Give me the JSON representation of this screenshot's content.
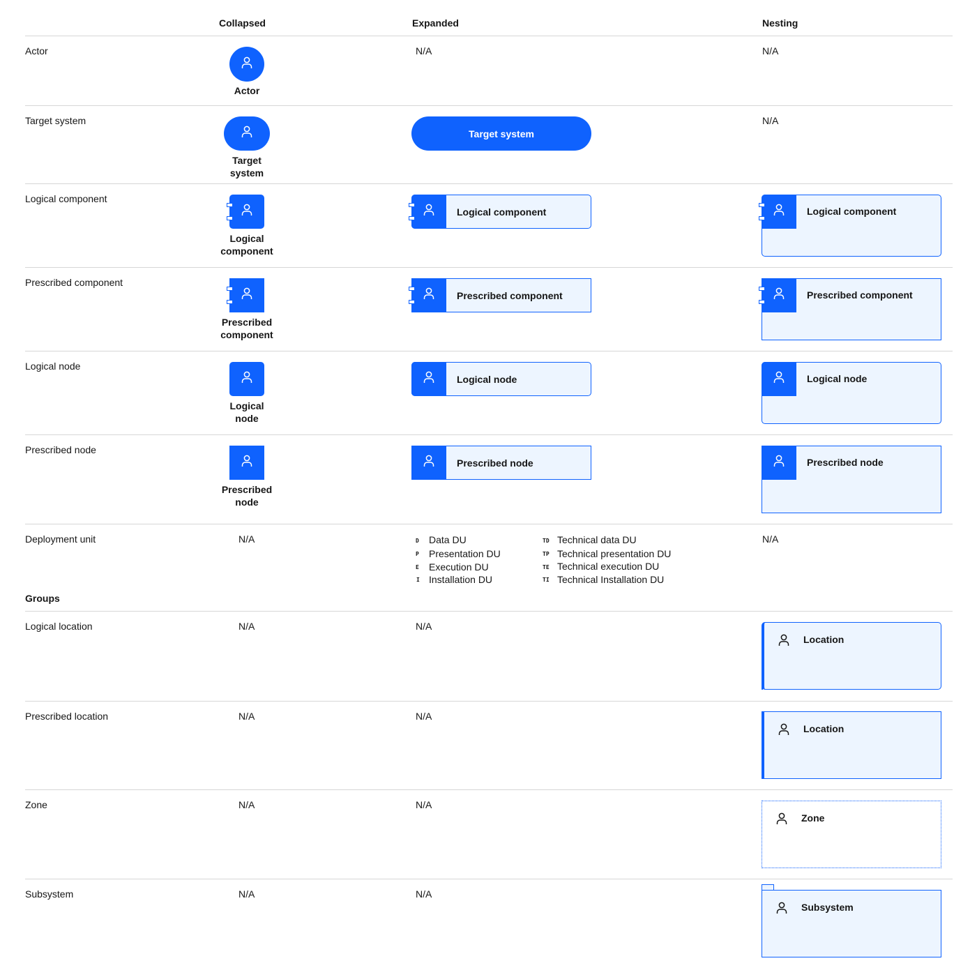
{
  "headers": {
    "collapsed": "Collapsed",
    "expanded": "Expanded",
    "nesting": "Nesting"
  },
  "na": "N/A",
  "rows": {
    "actor": {
      "label": "Actor",
      "caption": "Actor"
    },
    "target_system": {
      "label": "Target system",
      "caption_line1": "Target",
      "caption_line2": "system",
      "expanded": "Target system"
    },
    "logical_component": {
      "label": "Logical component",
      "caption_line1": "Logical",
      "caption_line2": "component",
      "expanded": "Logical component",
      "nesting": "Logical component"
    },
    "prescribed_component": {
      "label": "Prescribed component",
      "caption_line1": "Prescribed",
      "caption_line2": "component",
      "expanded": "Prescribed component",
      "nesting": "Prescribed component"
    },
    "logical_node": {
      "label": "Logical node",
      "caption_line1": "Logical",
      "caption_line2": "node",
      "expanded": "Logical node",
      "nesting": "Logical node"
    },
    "prescribed_node": {
      "label": "Prescribed node",
      "caption_line1": "Prescribed",
      "caption_line2": "node",
      "expanded": "Prescribed node",
      "nesting": "Prescribed node"
    },
    "deployment_unit": {
      "label": "Deployment unit",
      "types": [
        {
          "code": "D",
          "name": "Data DU"
        },
        {
          "code": "P",
          "name": "Presentation DU"
        },
        {
          "code": "E",
          "name": "Execution DU"
        },
        {
          "code": "I",
          "name": "Installation DU"
        },
        {
          "code": "TD",
          "name": "Technical data DU"
        },
        {
          "code": "TP",
          "name": "Technical presentation DU"
        },
        {
          "code": "TE",
          "name": "Technical execution DU"
        },
        {
          "code": "TI",
          "name": "Technical Installation DU"
        }
      ]
    }
  },
  "groups_heading": "Groups",
  "groups": {
    "logical_location": {
      "label": "Logical location",
      "nesting": "Location"
    },
    "prescribed_location": {
      "label": "Prescribed location",
      "nesting": "Location"
    },
    "zone": {
      "label": "Zone",
      "nesting": "Zone"
    },
    "subsystem": {
      "label": "Subsystem",
      "nesting": "Subsystem"
    }
  },
  "colors": {
    "accent": "#0f62fe",
    "fill": "#edf5ff",
    "rule": "#d6d6d6",
    "text": "#161616"
  },
  "icons": {
    "element": "user-icon"
  }
}
